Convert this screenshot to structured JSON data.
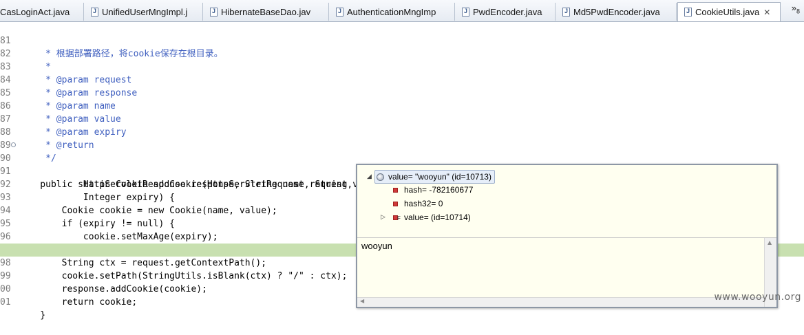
{
  "tabs": [
    {
      "label": "CasLoginAct.java"
    },
    {
      "label": "UnifiedUserMngImpl.j"
    },
    {
      "label": "HibernateBaseDao.jav"
    },
    {
      "label": "AuthenticationMngImp"
    },
    {
      "label": "PwdEncoder.java"
    },
    {
      "label": "Md5PwdEncoder.java"
    },
    {
      "label": "CookieUtils.java",
      "active": true
    }
  ],
  "tab_close": "✕",
  "tab_overflow": {
    "symbol": "»",
    "count": "8"
  },
  "editor": {
    "highlight_color": "#c8e0b0",
    "lines": [
      {
        "num": "81",
        "text": "     * 根据部署路径，将cookie保存在根目录。"
      },
      {
        "num": "82",
        "text": "     *"
      },
      {
        "num": "83",
        "text": "     * @param request"
      },
      {
        "num": "84",
        "text": "     * @param response"
      },
      {
        "num": "85",
        "text": "     * @param name"
      },
      {
        "num": "86",
        "text": "     * @param value"
      },
      {
        "num": "87",
        "text": "     * @param expiry"
      },
      {
        "num": "88",
        "text": "     * @return"
      },
      {
        "num": "89",
        "text": "     */"
      },
      {
        "num": "90",
        "text": "    public static Cookie addCookie(HttpServletRequest request,"
      },
      {
        "num": "91",
        "text": "            HttpServletResponse response, String name, String value,"
      },
      {
        "num": "92",
        "text": "            Integer expiry) {"
      },
      {
        "num": "93",
        "text": "        Cookie cookie = new Cookie(name, value);"
      },
      {
        "num": "94",
        "text": "        if (expiry != null) {"
      },
      {
        "num": "95",
        "text": "            cookie.setMaxAge(expiry);"
      },
      {
        "num": "96",
        "text": "        }"
      },
      {
        "num": "97",
        "text": "        String ctx = request.getContextPath();"
      },
      {
        "num": "98",
        "text": "        cookie.setPath(StringUtils.isBlank(ctx) ? \"/\" : ctx);"
      },
      {
        "num": "99",
        "text": "        response.addCookie(cookie);"
      },
      {
        "num": "00",
        "text": "        return cookie;"
      },
      {
        "num": "01",
        "text": "    }"
      }
    ]
  },
  "popup": {
    "root": "value= \"wooyun\" (id=10713)",
    "fields": [
      {
        "label": "hash= -782160677"
      },
      {
        "label": "hash32= 0"
      },
      {
        "label": "value=  (id=10714)"
      }
    ],
    "final_marker": "F",
    "detail_text": "wooyun"
  },
  "watermark": "www.wooyun.org"
}
